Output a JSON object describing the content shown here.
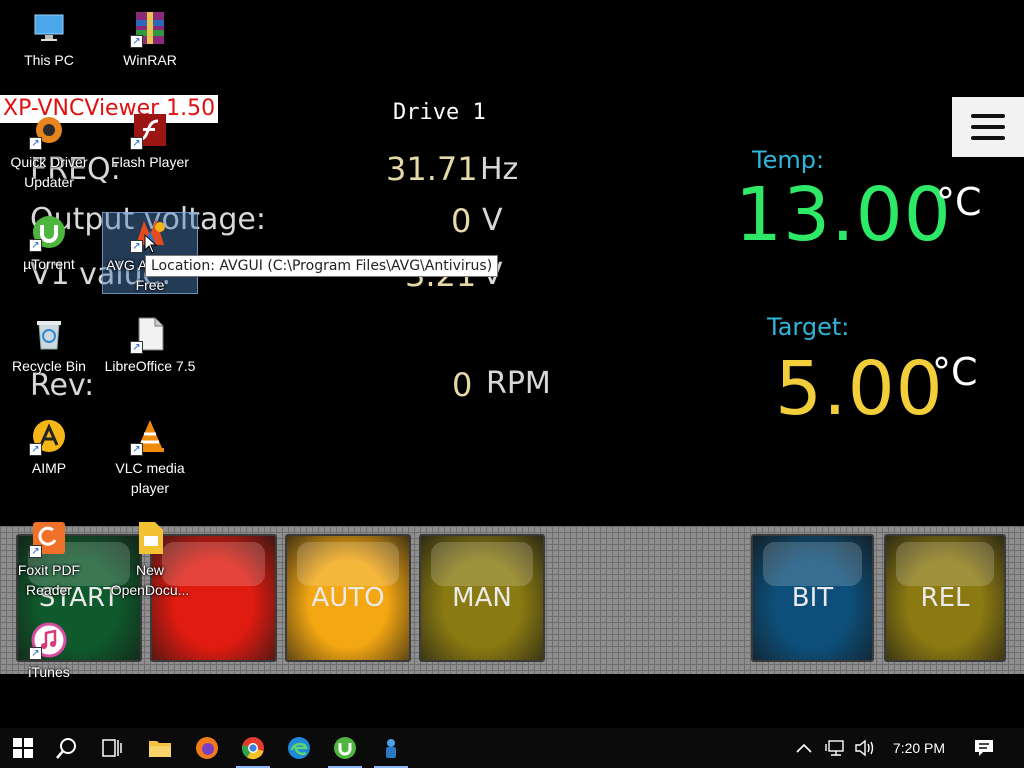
{
  "vnc": {
    "window_title": "XP-VNCViewer 1.50",
    "drive_title": "Drive 1",
    "params": [
      {
        "label": "FREQ:",
        "value": "31.71",
        "unit": "Hz"
      },
      {
        "label": "Output voltage:",
        "value": "0",
        "unit": "V"
      },
      {
        "label": "V1 value:",
        "value": "3.21",
        "unit": "V"
      },
      {
        "label": "Rev:",
        "value": "0",
        "unit": "RPM"
      }
    ],
    "temp": {
      "label": "Temp:",
      "value": "13.00",
      "unit": "°C",
      "color": "#2ee868"
    },
    "target": {
      "label": "Target:",
      "value": "5.00",
      "unit": "°C",
      "color": "#f2cf3a"
    },
    "buttons": [
      {
        "label": "START",
        "color": "#0f5a2c"
      },
      {
        "label": "",
        "color": "#e01b10"
      },
      {
        "label": "AUTO",
        "color": "#f3a712"
      },
      {
        "label": "MAN",
        "color": "#8a7a12"
      },
      {
        "label": "BIT",
        "color": "#0d4f7a"
      },
      {
        "label": "REL",
        "color": "#8b7912"
      }
    ]
  },
  "desktop": {
    "icons": [
      {
        "label": "This PC",
        "icon": "computer-icon"
      },
      {
        "label": "WinRAR",
        "icon": "winrar-icon"
      },
      {
        "label": "Quick Driver Updater",
        "icon": "gear-icon"
      },
      {
        "label": "Flash Player",
        "icon": "flash-icon"
      },
      {
        "label": "µTorrent",
        "icon": "utorrent-icon"
      },
      {
        "label": "AVG AntiVirus Free",
        "icon": "avg-icon"
      },
      {
        "label": "Recycle Bin",
        "icon": "recycle-bin-icon"
      },
      {
        "label": "LibreOffice 7.5",
        "icon": "libreoffice-icon"
      },
      {
        "label": "AIMP",
        "icon": "aimp-icon"
      },
      {
        "label": "VLC media player",
        "icon": "vlc-icon"
      },
      {
        "label": "Foxit PDF Reader",
        "icon": "foxit-icon"
      },
      {
        "label": "New OpenDocu...",
        "icon": "document-icon"
      },
      {
        "label": "iTunes",
        "icon": "itunes-icon"
      }
    ],
    "tooltip": "Location: AVGUI (C:\\Program Files\\AVG\\Antivirus)"
  },
  "taskbar": {
    "apps": [
      "start-icon",
      "search-icon",
      "task-view-icon",
      "file-explorer-icon",
      "firefox-icon",
      "chrome-icon",
      "edge-icon",
      "utorrent-icon",
      "vnc-viewer-icon"
    ],
    "clock": "7:20 PM"
  }
}
